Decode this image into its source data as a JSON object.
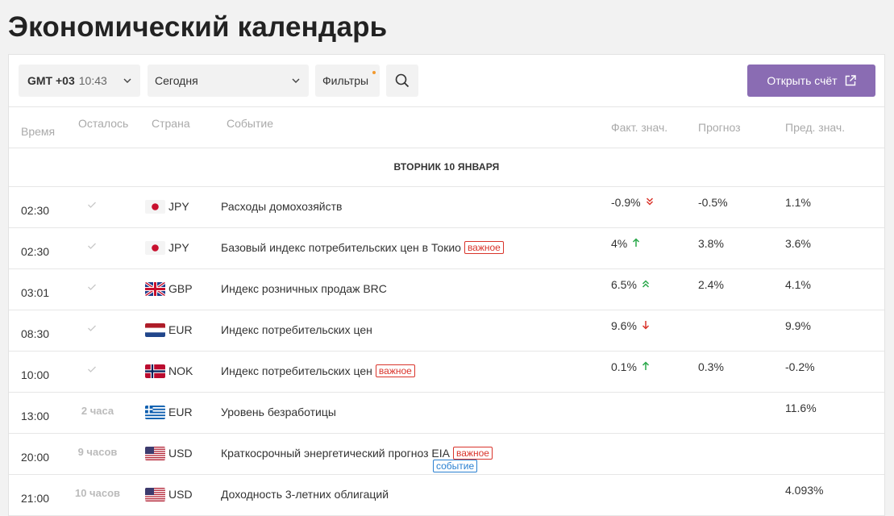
{
  "page_title": "Экономический календарь",
  "toolbar": {
    "timezone": "GMT +03",
    "time": "10:43",
    "date_value": "Сегодня",
    "filters_label": "Фильтры",
    "open_account_label": "Открыть счёт"
  },
  "columns": {
    "time": "Время",
    "remaining": "Осталось",
    "country": "Страна",
    "event": "Событие",
    "actual": "Факт. знач.",
    "forecast": "Прогноз",
    "previous": "Пред. знач."
  },
  "day_header": "ВТОРНИК 10 ЯНВАРЯ",
  "badges": {
    "important": "важное",
    "event": "событие"
  },
  "rows": [
    {
      "time": "02:30",
      "remaining": "",
      "done": true,
      "flag": "jp",
      "currency": "JPY",
      "event": "Расходы домохозяйств",
      "important": false,
      "is_event": false,
      "actual": "-0.9%",
      "trend": "strong-down",
      "forecast": "-0.5%",
      "previous": "1.1%"
    },
    {
      "time": "02:30",
      "remaining": "",
      "done": true,
      "flag": "jp",
      "currency": "JPY",
      "event": "Базовый индекс потребительских цен в Токио",
      "important": true,
      "is_event": false,
      "actual": "4%",
      "trend": "up",
      "forecast": "3.8%",
      "previous": "3.6%"
    },
    {
      "time": "03:01",
      "remaining": "",
      "done": true,
      "flag": "gb",
      "currency": "GBP",
      "event": "Индекс розничных продаж BRC",
      "important": false,
      "is_event": false,
      "actual": "6.5%",
      "trend": "strong-up",
      "forecast": "2.4%",
      "previous": "4.1%"
    },
    {
      "time": "08:30",
      "remaining": "",
      "done": true,
      "flag": "nl",
      "currency": "EUR",
      "event": "Индекс потребительских цен",
      "important": false,
      "is_event": false,
      "actual": "9.6%",
      "trend": "down",
      "forecast": "",
      "previous": "9.9%"
    },
    {
      "time": "10:00",
      "remaining": "",
      "done": true,
      "flag": "no",
      "currency": "NOK",
      "event": "Индекс потребительских цен",
      "important": true,
      "is_event": false,
      "actual": "0.1%",
      "trend": "up",
      "forecast": "0.3%",
      "previous": "-0.2%"
    },
    {
      "time": "13:00",
      "remaining": "2 часа",
      "done": false,
      "flag": "gr",
      "currency": "EUR",
      "event": "Уровень безработицы",
      "important": false,
      "is_event": false,
      "actual": "",
      "trend": "",
      "forecast": "",
      "previous": "11.6%"
    },
    {
      "time": "20:00",
      "remaining": "9 часов",
      "done": false,
      "flag": "us",
      "currency": "USD",
      "event": "Краткосрочный энергетический прогноз EIA",
      "important": true,
      "is_event": true,
      "actual": "",
      "trend": "",
      "forecast": "",
      "previous": ""
    },
    {
      "time": "21:00",
      "remaining": "10 часов",
      "done": false,
      "flag": "us",
      "currency": "USD",
      "event": "Доходность 3-летних облигаций",
      "important": false,
      "is_event": false,
      "actual": "",
      "trend": "",
      "forecast": "",
      "previous": "4.093%"
    }
  ],
  "colors": {
    "accent": "#8a6cb3",
    "up": "#2aa84a",
    "down": "#d9342b",
    "important": "#d9342b",
    "event": "#2a80d1"
  }
}
